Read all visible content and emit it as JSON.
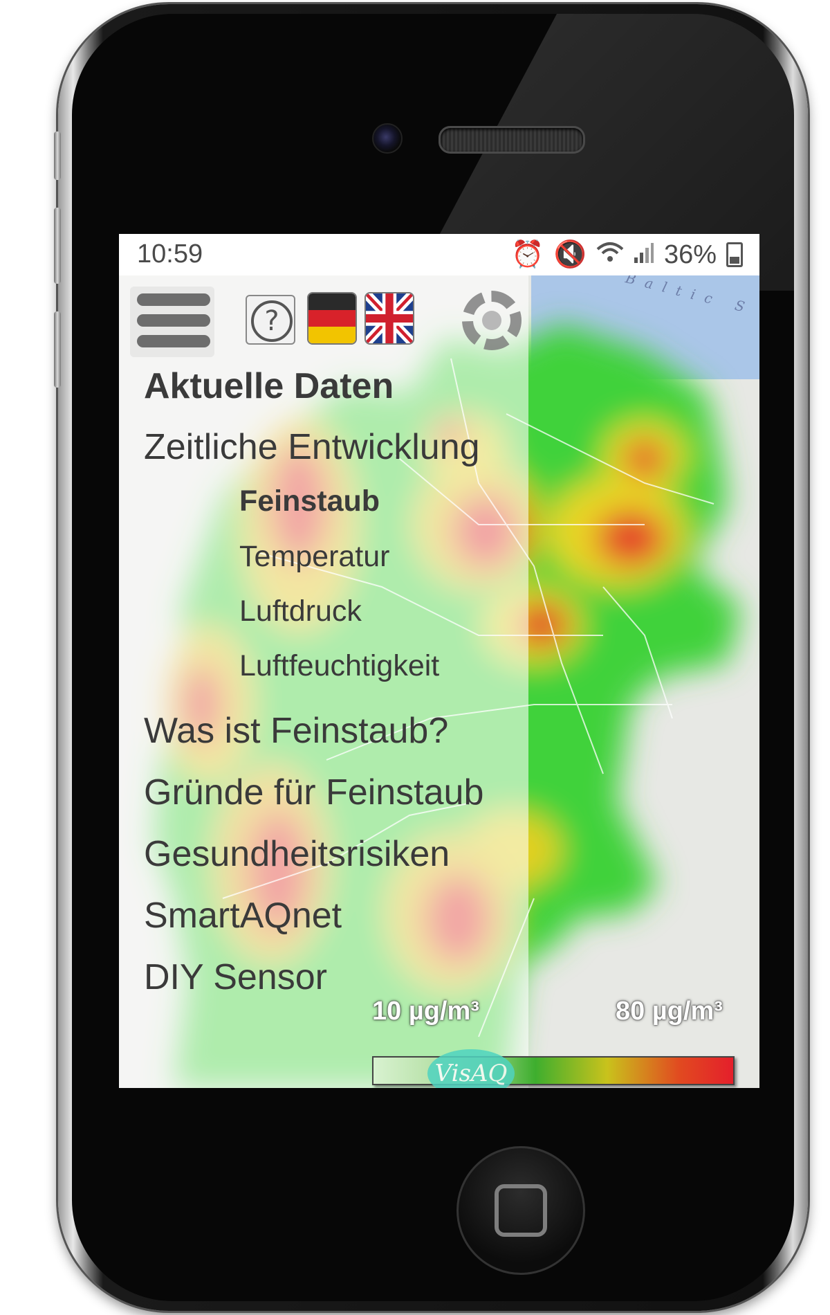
{
  "status_bar": {
    "time": "10:59",
    "battery": "36%",
    "icons": [
      "alarm-icon",
      "mute-icon",
      "wifi-icon",
      "signal-icon",
      "battery-icon"
    ]
  },
  "header": {
    "help_symbol": "?",
    "flags": [
      "germany-flag-icon",
      "uk-flag-icon"
    ],
    "settings_icon": "gear-icon"
  },
  "map": {
    "sea_label": "Baltic S",
    "legend": {
      "min_label": "10 µg/m³",
      "max_label": "80 µg/m³",
      "low_color": "#d8f2d0",
      "high_color": "#e41f2b"
    },
    "logo": "VisAQ"
  },
  "menu": {
    "items": [
      {
        "label": "Aktuelle Daten"
      },
      {
        "label": "Zeitliche Entwicklung"
      },
      {
        "label": "Feinstaub"
      },
      {
        "label": "Temperatur"
      },
      {
        "label": "Luftdruck"
      },
      {
        "label": "Luftfeuchtigkeit"
      },
      {
        "label": "Was ist Feinstaub?"
      },
      {
        "label": "Gründe für Feinstaub"
      },
      {
        "label": "Gesundheitsrisiken"
      },
      {
        "label": "SmartAQnet"
      },
      {
        "label": "DIY Sensor"
      }
    ]
  }
}
